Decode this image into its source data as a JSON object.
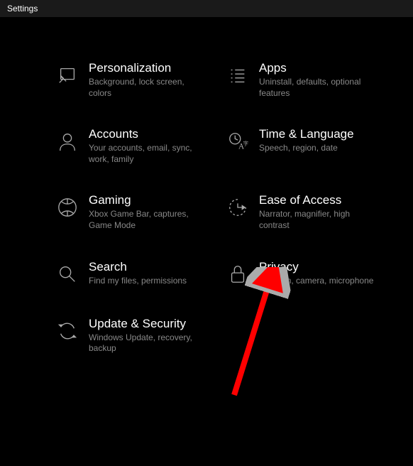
{
  "window": {
    "title": "Settings"
  },
  "tiles": [
    {
      "title": "Personalization",
      "subtitle": "Background, lock screen, colors"
    },
    {
      "title": "Apps",
      "subtitle": "Uninstall, defaults, optional features"
    },
    {
      "title": "Accounts",
      "subtitle": "Your accounts, email, sync, work, family"
    },
    {
      "title": "Time & Language",
      "subtitle": "Speech, region, date"
    },
    {
      "title": "Gaming",
      "subtitle": "Xbox Game Bar, captures, Game Mode"
    },
    {
      "title": "Ease of Access",
      "subtitle": "Narrator, magnifier, high contrast"
    },
    {
      "title": "Search",
      "subtitle": "Find my files, permissions"
    },
    {
      "title": "Privacy",
      "subtitle": "Location, camera, microphone"
    },
    {
      "title": "Update & Security",
      "subtitle": "Windows Update, recovery, backup"
    }
  ],
  "annotation": {
    "arrow_target": "ease-of-access"
  }
}
